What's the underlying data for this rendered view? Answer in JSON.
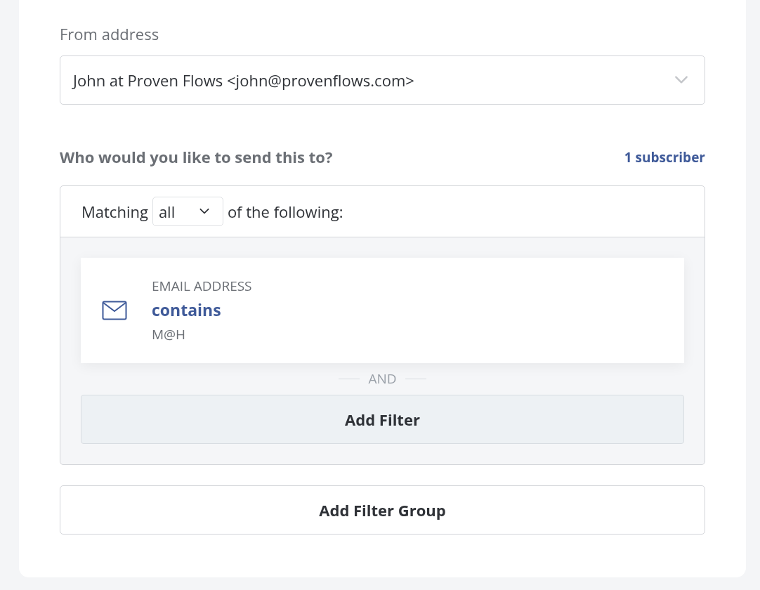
{
  "from_address": {
    "label": "From address",
    "value": "John at Proven Flows <john@provenflows.com>"
  },
  "recipients": {
    "label": "Who would you like to send this to?",
    "count_link": "1 subscriber",
    "matching": {
      "prefix": "Matching",
      "value": "all",
      "suffix": "of the following:"
    },
    "filters": [
      {
        "kind": "email",
        "field": "EMAIL ADDRESS",
        "operator": "contains",
        "value": "M@H"
      }
    ],
    "separator": "AND",
    "add_filter": "Add Filter"
  },
  "add_filter_group": "Add Filter Group"
}
